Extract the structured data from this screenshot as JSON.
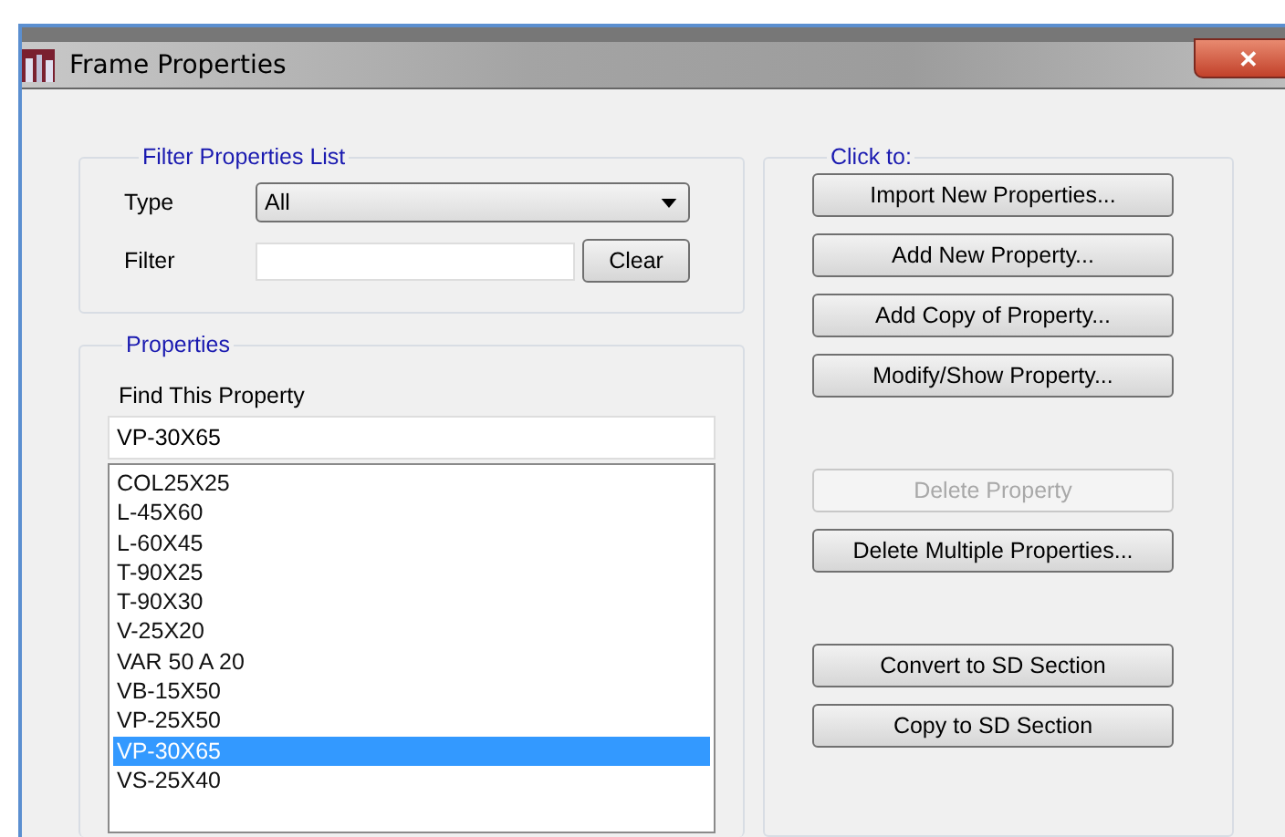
{
  "window": {
    "title": "Frame Properties",
    "close_label": "✕"
  },
  "filter": {
    "title": "Filter Properties List",
    "type_label": "Type",
    "type_value": "All",
    "filter_label": "Filter",
    "clear_button": "Clear"
  },
  "properties": {
    "title": "Properties",
    "find_label": "Find This Property",
    "find_value": "VP-30X65",
    "items": [
      {
        "label": "COL25X25",
        "selected": false
      },
      {
        "label": "L-45X60",
        "selected": false
      },
      {
        "label": "L-60X45",
        "selected": false
      },
      {
        "label": "T-90X25",
        "selected": false
      },
      {
        "label": "T-90X30",
        "selected": false
      },
      {
        "label": "V-25X20",
        "selected": false
      },
      {
        "label": "VAR 50 A 20",
        "selected": false
      },
      {
        "label": "VB-15X50",
        "selected": false
      },
      {
        "label": "VP-25X50",
        "selected": false
      },
      {
        "label": "VP-30X65",
        "selected": true
      },
      {
        "label": "VS-25X40",
        "selected": false
      }
    ]
  },
  "actions": {
    "title": "Click to:",
    "button_groups": [
      [
        {
          "label": "Import New Properties...",
          "disabled": false
        },
        {
          "label": "Add New Property...",
          "disabled": false
        },
        {
          "label": "Add Copy of Property...",
          "disabled": false
        },
        {
          "label": "Modify/Show Property...",
          "disabled": false
        }
      ],
      [
        {
          "label": "Delete Property",
          "disabled": true
        },
        {
          "label": "Delete Multiple Properties...",
          "disabled": false
        }
      ],
      [
        {
          "label": "Convert to SD Section",
          "disabled": false
        },
        {
          "label": "Copy to SD Section",
          "disabled": false
        }
      ]
    ]
  }
}
